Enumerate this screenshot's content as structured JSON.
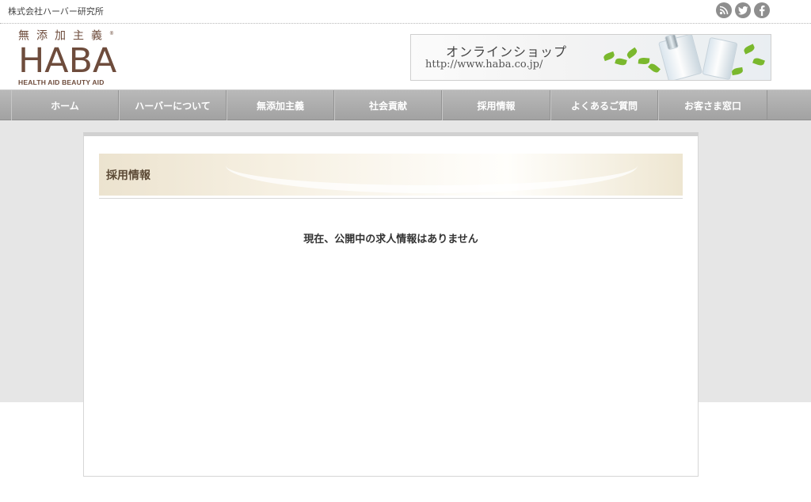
{
  "header": {
    "company_name": "株式会社ハーバー研究所",
    "social_icons": [
      "rss-icon",
      "twitter-icon",
      "facebook-icon"
    ],
    "logo": {
      "tagline": "無添加主義",
      "registered_mark": "®",
      "main": "HABA",
      "sub": "HEALTH AID BEAUTY AID"
    },
    "shop_banner": {
      "title": "オンラインショップ",
      "url": "http://www.haba.co.jp/"
    }
  },
  "nav": {
    "items": [
      {
        "label": "ホーム"
      },
      {
        "label": "ハーバーについて"
      },
      {
        "label": "無添加主義"
      },
      {
        "label": "社会貢献"
      },
      {
        "label": "採用情報"
      },
      {
        "label": "よくあるご質問"
      },
      {
        "label": "お客さま窓口"
      }
    ]
  },
  "main": {
    "section_title": "採用情報",
    "message": "現在、公開中の求人情報はありません"
  },
  "colors": {
    "brand_brown": "#6e4c3c",
    "nav_gray": "#aaaaaa",
    "background_gray": "#e6e6e6"
  }
}
